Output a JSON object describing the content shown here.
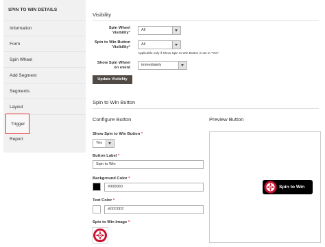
{
  "sidebar": {
    "title": "SPIN TO WIN DETAILS",
    "items": [
      {
        "label": "Information"
      },
      {
        "label": "Form"
      },
      {
        "label": "Spin Wheel"
      },
      {
        "label": "Add Segment"
      },
      {
        "label": "Segments"
      },
      {
        "label": "Layout"
      },
      {
        "label": "Trigger"
      },
      {
        "label": "Report"
      }
    ],
    "active": "Trigger"
  },
  "visibility": {
    "heading": "Visibility",
    "spin_wheel_label_1": "Spin Wheel",
    "spin_wheel_label_2": "Visibility",
    "spin_wheel_value": "All",
    "button_label_1": "Spin to Win Button",
    "button_label_2": "Visibility",
    "button_value": "All",
    "button_note": "Applicable only if Show Spin to Win Button is set to \"Yes\".",
    "show_label_1": "Show Spin Wheel",
    "show_label_2": "on event",
    "show_value": "immediately",
    "update_button": "Update Visibility"
  },
  "spin_button": {
    "heading": "Spin to Win Button",
    "configure_heading": "Configure Button",
    "preview_heading": "Preview Button",
    "show_label": "Show Spin to Win Button",
    "show_value": "Yes",
    "button_label_label": "Button Label",
    "button_label_value": "Spin to Win",
    "bg_label": "Background Color",
    "bg_value": "#000000",
    "text_color_label": "Text Color",
    "text_color_value": "#FFFFFF",
    "image_label": "Spin to Win Image",
    "preview_text": "Spin to Win"
  },
  "colors": {
    "accent_red": "#e02b27",
    "button_dark": "#514943",
    "bg_swatch": "#000000",
    "text_swatch": "#FFFFFF",
    "wheel_red": "#c8102e"
  },
  "icons": {
    "select_arrow": "chevron-down-icon",
    "wheel": "spin-wheel-icon"
  }
}
